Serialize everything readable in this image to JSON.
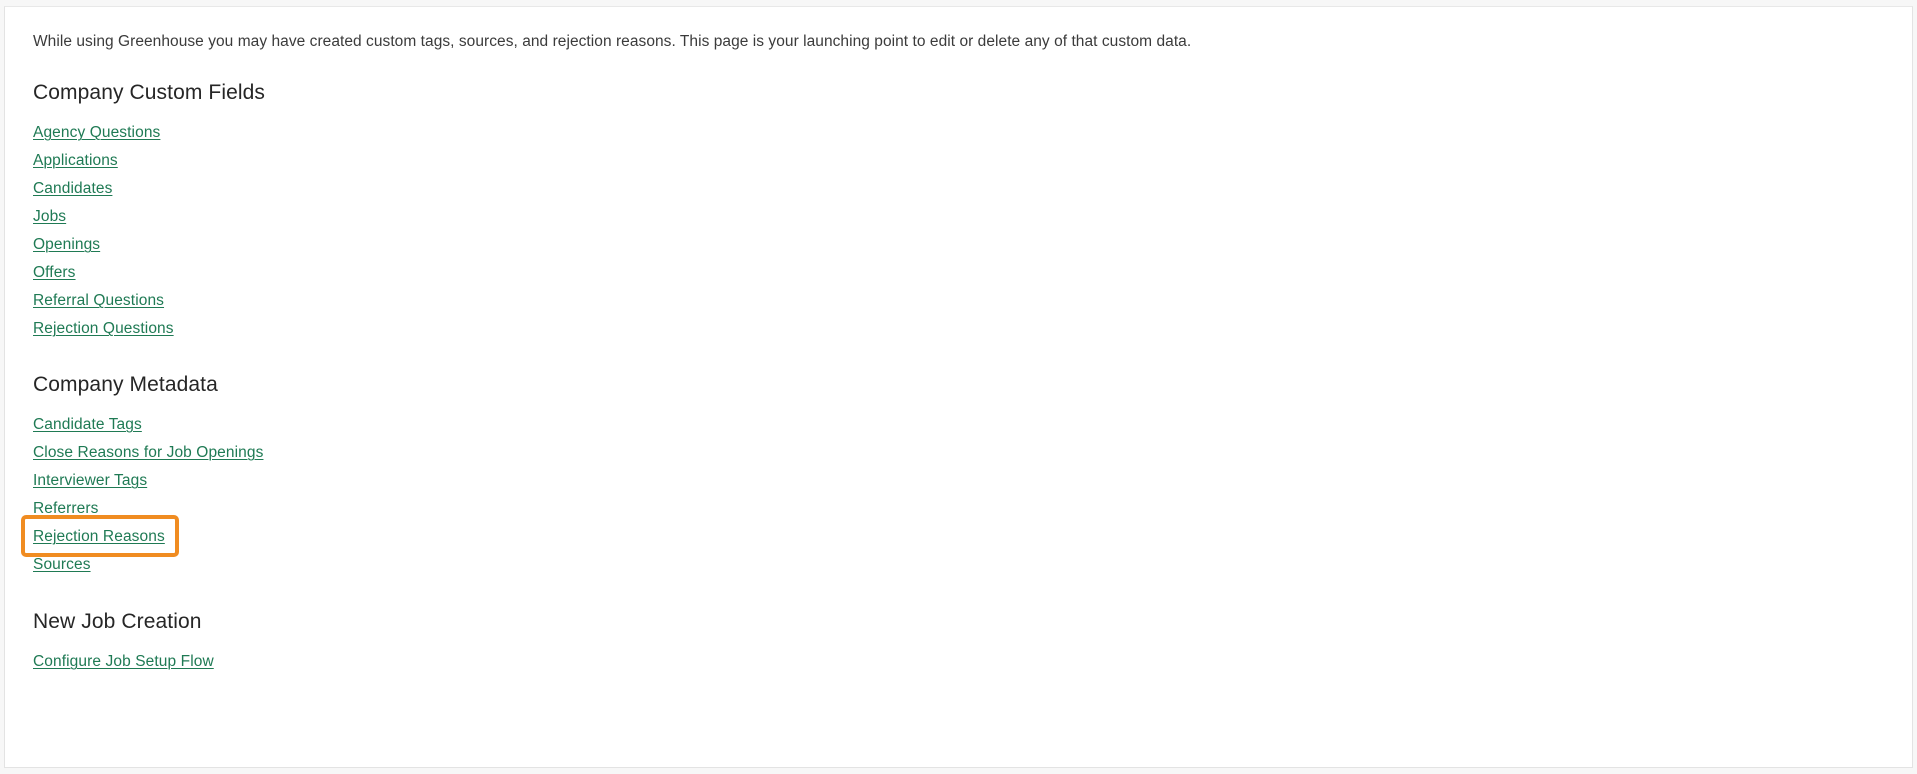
{
  "page": {
    "intro_text": "While using Greenhouse you may have created custom tags, sources, and rejection reasons. This page is your launching point to edit or delete any of that custom data."
  },
  "colors": {
    "link_green": "#1f7a54",
    "highlight_orange": "#f08c21",
    "heading_text": "#262626",
    "body_text": "#3b3b3b",
    "card_background": "#ffffff",
    "page_background": "#f7f7f7",
    "card_border": "#e3e3e3"
  },
  "sections": [
    {
      "heading": "Company Custom Fields",
      "links": [
        {
          "label": "Agency Questions",
          "highlighted": false
        },
        {
          "label": "Applications",
          "highlighted": false
        },
        {
          "label": "Candidates",
          "highlighted": false
        },
        {
          "label": "Jobs",
          "highlighted": false
        },
        {
          "label": "Openings",
          "highlighted": false
        },
        {
          "label": "Offers",
          "highlighted": false
        },
        {
          "label": "Referral Questions",
          "highlighted": false
        },
        {
          "label": "Rejection Questions",
          "highlighted": false
        }
      ]
    },
    {
      "heading": "Company Metadata",
      "links": [
        {
          "label": "Candidate Tags",
          "highlighted": false
        },
        {
          "label": "Close Reasons for Job Openings",
          "highlighted": false
        },
        {
          "label": "Interviewer Tags",
          "highlighted": false
        },
        {
          "label": "Referrers",
          "highlighted": false
        },
        {
          "label": "Rejection Reasons",
          "highlighted": true
        },
        {
          "label": "Sources",
          "highlighted": false
        }
      ]
    },
    {
      "heading": "New Job Creation",
      "links": [
        {
          "label": "Configure Job Setup Flow",
          "highlighted": false
        }
      ]
    }
  ]
}
